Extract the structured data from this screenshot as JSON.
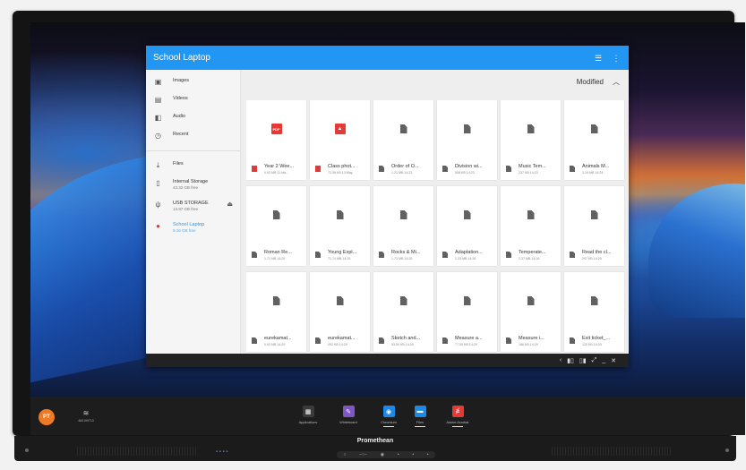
{
  "window": {
    "title": "School Laptop"
  },
  "sidebar": {
    "items": [
      {
        "label": "Images",
        "icon": "image-icon"
      },
      {
        "label": "Videos",
        "icon": "video-icon"
      },
      {
        "label": "Audio",
        "icon": "audio-icon"
      },
      {
        "label": "Recent",
        "icon": "clock-icon"
      }
    ],
    "storage": [
      {
        "label": "Files",
        "sub": "",
        "icon": "download-icon"
      },
      {
        "label": "Internal Storage",
        "sub": "43.32 GB free",
        "icon": "phone-icon"
      },
      {
        "label": "USB STORAGE",
        "sub": "13.97 GB free",
        "icon": "usb-icon"
      },
      {
        "label": "School Laptop",
        "sub": "9.16 GB free",
        "icon": "laptop-icon"
      }
    ]
  },
  "sort": {
    "label": "Modified"
  },
  "files": [
    {
      "name": "Year 2 Wee...",
      "meta": "0.92 MB 11 Ma...",
      "type": "pdf"
    },
    {
      "name": "Class phot...",
      "meta": "71.36 KB 13 May",
      "type": "image"
    },
    {
      "name": "Order of O...",
      "meta": "1.21 MB 14:23",
      "type": "doc"
    },
    {
      "name": "Division wi...",
      "meta": "508 KB 14:23",
      "type": "doc"
    },
    {
      "name": "Music Tem...",
      "meta": "237 KB 14:23",
      "type": "doc"
    },
    {
      "name": "Animals M...",
      "meta": "3.19 MB 14:24",
      "type": "doc"
    },
    {
      "name": "Roman Re...",
      "meta": "1.71 MB 14:25",
      "type": "doc"
    },
    {
      "name": "Young Expl...",
      "meta": "71.74 MB 14:25",
      "type": "doc"
    },
    {
      "name": "Rocks & Mi...",
      "meta": "1.73 MB 14:25",
      "type": "doc"
    },
    {
      "name": "Adaptation...",
      "meta": "2.33 MB 14:26",
      "type": "doc"
    },
    {
      "name": "Temperate...",
      "meta": "2.37 MB 14:26",
      "type": "doc"
    },
    {
      "name": "Read the cl...",
      "meta": "297 KB 14:29",
      "type": "doc"
    },
    {
      "name": "eurekamat...",
      "meta": "0.92 MB 14:29",
      "type": "doc"
    },
    {
      "name": "eurekamat...",
      "meta": "492 KB 14:29",
      "type": "doc"
    },
    {
      "name": "Sketch and...",
      "meta": "93.50 KB 14:29",
      "type": "doc"
    },
    {
      "name": "Measure a...",
      "meta": "77.50 KB 14:29",
      "type": "doc"
    },
    {
      "name": "Measure i...",
      "meta": "186 KB 14:29",
      "type": "doc"
    },
    {
      "name": "Exit ticket_...",
      "meta": "120 KB 14:30",
      "type": "doc"
    }
  ],
  "taskbar": {
    "avatar": "PT",
    "network": "460199713",
    "apps": [
      {
        "label": "Applications",
        "icon": "apps-grid-icon",
        "color": "#3a3a3a"
      },
      {
        "label": "Whiteboard",
        "icon": "whiteboard-icon",
        "color": "#7e57c2"
      },
      {
        "label": "Chromium",
        "icon": "chromium-icon",
        "color": "#1e88e5"
      },
      {
        "label": "Files",
        "icon": "folder-icon",
        "color": "#1e88e5"
      },
      {
        "label": "Adobe Acrobat",
        "icon": "acrobat-icon",
        "color": "#e53935"
      }
    ]
  },
  "device": {
    "brand": "Promethean"
  }
}
